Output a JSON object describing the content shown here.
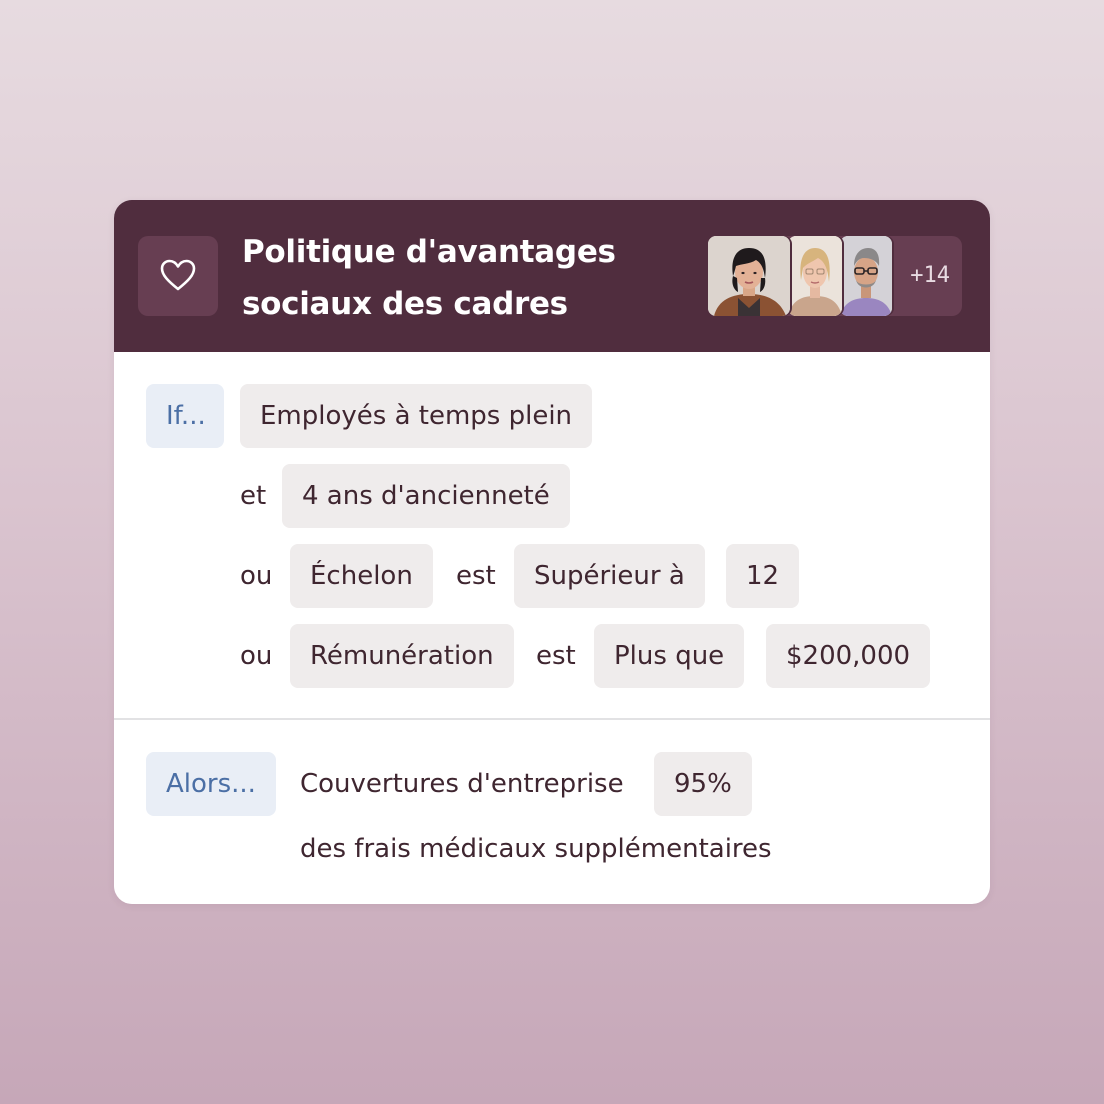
{
  "header": {
    "title_line1": "Politique d'avantages",
    "title_line2": "sociaux des cadres",
    "favorite_icon": "heart-icon",
    "members_extra": "+14",
    "avatars": [
      "person-1",
      "person-2",
      "person-3"
    ]
  },
  "conditions": {
    "if_label": "If...",
    "rows": [
      {
        "value": "Employés à temps plein"
      },
      {
        "connector": "et",
        "value": "4 ans d'ancienneté"
      },
      {
        "connector": "ou",
        "field": "Échelon",
        "verb": "est",
        "operator": "Supérieur à",
        "value": "12"
      },
      {
        "connector": "ou",
        "field": "Rémunération",
        "verb": "est",
        "operator": "Plus que",
        "value": "$200,000"
      }
    ]
  },
  "outcome": {
    "then_label": "Alors...",
    "text": "Couvertures d'entreprise",
    "value": "95%",
    "description": "des frais médicaux supplémentaires"
  },
  "colors": {
    "header_bg": "#502d3e",
    "header_chip_bg": "#673e52",
    "keyword_text": "#4b6fa5",
    "keyword_bg": "#e9eef6",
    "chip_bg": "#efecec",
    "text": "#3f2630"
  }
}
